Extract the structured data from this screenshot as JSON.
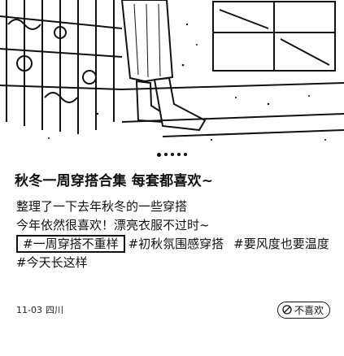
{
  "post": {
    "title": "秋冬一周穿搭合集 每套都喜欢~",
    "body_lines": [
      "整理了一下去年秋冬的一些穿搭",
      "今年依然很喜欢！漂亮衣服不过时~"
    ],
    "tags_row1": [
      "#一周穿搭不重样",
      "#初秋氛围感穿搭",
      "#要风度也要温度"
    ],
    "tags_row2": [
      "#今天长这样"
    ],
    "date": "11-03",
    "location": "四川",
    "dislike_label": "不喜欢"
  },
  "carousel": {
    "total": 5,
    "active_index": 0
  },
  "icons": {
    "dislike": "dislike-icon"
  },
  "colors": {
    "text": "#111111",
    "background": "#ffffff"
  }
}
